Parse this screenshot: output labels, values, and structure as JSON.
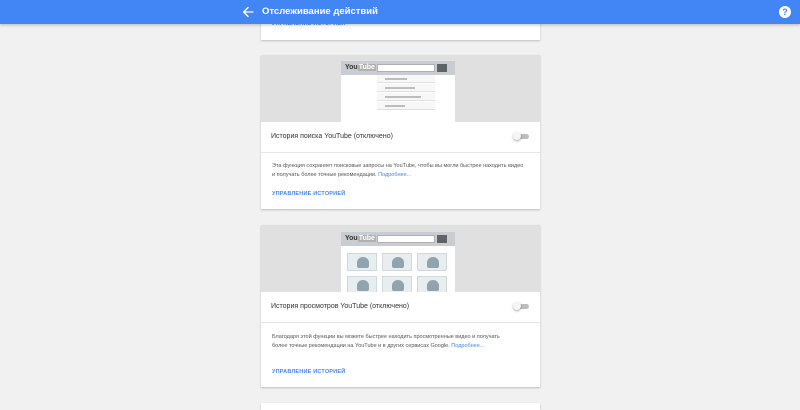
{
  "header": {
    "title": "Отслеживание действий",
    "back_icon": "arrow-back-icon",
    "help_icon": "help-icon",
    "help_glyph": "?"
  },
  "top_card": {
    "manage_label": "УПРАВЛЕНИЕ ИСТОРИЕЙ"
  },
  "search_card": {
    "logo_text": "You",
    "logo_badge": "Tube",
    "setting_label": "История поиска YouTube (отключено)",
    "toggle_on": false,
    "description": "Эта функция сохраняет поисковые запросы на YouTube, чтобы вы могли быстрее находить видео и получать более точные рекомендации.",
    "more_link": "Подробнее...",
    "manage_label": "УПРАВЛЕНИЕ ИСТОРИЕЙ"
  },
  "watch_card": {
    "logo_text": "You",
    "logo_badge": "Tube",
    "setting_label": "История просмотров YouTube (отключено)",
    "toggle_on": false,
    "description": "Благодаря этой функции вы можете быстрее находить просмотренные видео и получать более точные рекомендации на YouTube и в других сервисах Google.",
    "more_link": "Подробнее...",
    "manage_label": "УПРАВЛЕНИЕ ИСТОРИЕЙ"
  },
  "colors": {
    "app_bar": "#4285f4",
    "link": "#4285f4",
    "background": "#f1f1f1"
  }
}
